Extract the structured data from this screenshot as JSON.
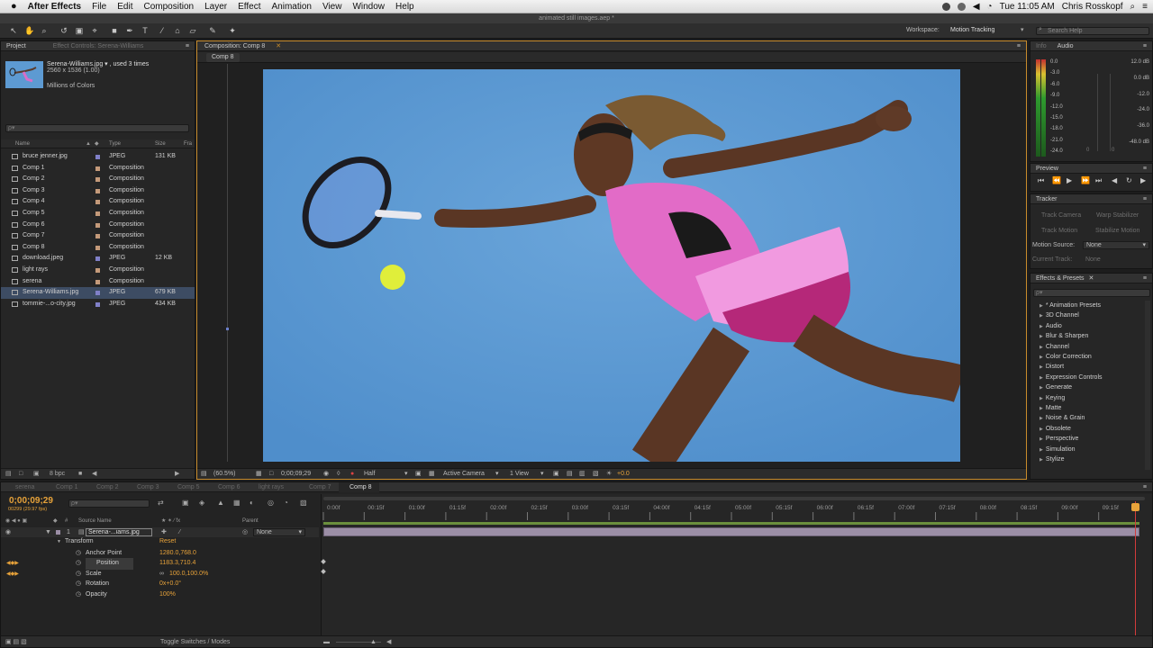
{
  "menubar": {
    "app": "After Effects",
    "items": [
      "File",
      "Edit",
      "Composition",
      "Layer",
      "Effect",
      "Animation",
      "View",
      "Window",
      "Help"
    ],
    "time": "Tue 11:05 AM",
    "user": "Chris Rosskopf"
  },
  "window_title": "animated still images.aep *",
  "toolbar": {
    "workspace_label": "Workspace:",
    "workspace_value": "Motion Tracking",
    "search_placeholder": "Search Help"
  },
  "project": {
    "tabs": [
      "Project",
      "Effect Controls: Serena-Williams"
    ],
    "selected_name": "Serena-Williams.jpg ▾ , used 3 times",
    "selected_dims": "2560 x 1536 (1.00)",
    "selected_colors": "Millions of Colors",
    "search_placeholder": "ρ▾",
    "columns": {
      "name": "Name",
      "type": "Type",
      "size": "Size",
      "fr": "Fra"
    },
    "items": [
      {
        "name": "bruce jenner.jpg",
        "type": "JPEG",
        "size": "131 KB",
        "kind": "jpeg"
      },
      {
        "name": "Comp 1",
        "type": "Composition",
        "size": "",
        "kind": "comp"
      },
      {
        "name": "Comp 2",
        "type": "Composition",
        "size": "",
        "kind": "comp"
      },
      {
        "name": "Comp 3",
        "type": "Composition",
        "size": "",
        "kind": "comp"
      },
      {
        "name": "Comp 4",
        "type": "Composition",
        "size": "",
        "kind": "comp"
      },
      {
        "name": "Comp 5",
        "type": "Composition",
        "size": "",
        "kind": "comp"
      },
      {
        "name": "Comp 6",
        "type": "Composition",
        "size": "",
        "kind": "comp"
      },
      {
        "name": "Comp 7",
        "type": "Composition",
        "size": "",
        "kind": "comp"
      },
      {
        "name": "Comp 8",
        "type": "Composition",
        "size": "",
        "kind": "comp"
      },
      {
        "name": "download.jpeg",
        "type": "JPEG",
        "size": "12 KB",
        "kind": "jpeg"
      },
      {
        "name": "light rays",
        "type": "Composition",
        "size": "",
        "kind": "comp"
      },
      {
        "name": "serena",
        "type": "Composition",
        "size": "",
        "kind": "comp"
      },
      {
        "name": "Serena-Williams.jpg",
        "type": "JPEG",
        "size": "679 KB",
        "kind": "jpeg",
        "selected": true
      },
      {
        "name": "tommie-...o-city.jpg",
        "type": "JPEG",
        "size": "434 KB",
        "kind": "jpeg"
      }
    ],
    "bpc": "8 bpc"
  },
  "composition": {
    "tab": "Composition: Comp 8",
    "breadcrumb": "Comp 8",
    "zoom": "(60.5%)",
    "timecode": "0;00;09;29",
    "resolution": "Half",
    "camera": "Active Camera",
    "view": "1 View",
    "exposure": "+0.0"
  },
  "info_audio": {
    "tabs": [
      "Info",
      "Audio"
    ],
    "left_db": [
      "0.0",
      "-3.0",
      "-6.0",
      "-9.0",
      "-12.0",
      "-15.0",
      "-18.0",
      "-21.0",
      "-24.0"
    ],
    "right_db": [
      "12.0 dB",
      "0.0 dB",
      "-12.0",
      "-24.0",
      "-36.0",
      "-48.0 dB"
    ],
    "bottom_zero_1": "0",
    "bottom_zero_2": "0"
  },
  "preview": {
    "title": "Preview"
  },
  "tracker": {
    "title": "Tracker",
    "track_camera": "Track Camera",
    "warp_stabilizer": "Warp Stabilizer",
    "track_motion": "Track Motion",
    "stabilize_motion": "Stabilize Motion",
    "motion_source_label": "Motion Source:",
    "motion_source_value": "None",
    "current_track_label": "Current Track:",
    "current_track_value": "None"
  },
  "effects": {
    "title": "Effects & Presets",
    "search_placeholder": "ρ▾",
    "items": [
      "* Animation Presets",
      "3D Channel",
      "Audio",
      "Blur & Sharpen",
      "Channel",
      "Color Correction",
      "Distort",
      "Expression Controls",
      "Generate",
      "Keying",
      "Matte",
      "Noise & Grain",
      "Obsolete",
      "Perspective",
      "Simulation",
      "Stylize"
    ]
  },
  "timeline": {
    "tabs": [
      {
        "label": "serena",
        "active": false
      },
      {
        "label": "Comp 1",
        "active": false
      },
      {
        "label": "Comp 2",
        "active": false
      },
      {
        "label": "Comp 3",
        "active": false
      },
      {
        "label": "Comp 5",
        "active": false
      },
      {
        "label": "Comp 6",
        "active": false
      },
      {
        "label": "light rays",
        "active": false
      },
      {
        "label": "Comp 7",
        "active": false
      },
      {
        "label": "Comp 8",
        "active": true
      }
    ],
    "timecode": "0;00;09;29",
    "frames": "00299 (29.97 fps)",
    "search_placeholder": "ρ▾",
    "col_source": "Source Name",
    "col_parent": "Parent",
    "layer_num": "1",
    "layer_name": "Serena-...iams.jpg",
    "parent_value": "None",
    "transform_label": "Transform",
    "reset_label": "Reset",
    "properties": [
      {
        "name": "Anchor Point",
        "value": "1280.0,768.0"
      },
      {
        "name": "Position",
        "value": "1183.3,710.4"
      },
      {
        "name": "Scale",
        "value": "100.0,100.0%"
      },
      {
        "name": "Rotation",
        "value": "0x+0.0°"
      },
      {
        "name": "Opacity",
        "value": "100%"
      }
    ],
    "ruler": [
      "0:00f",
      "00:15f",
      "01:00f",
      "01:15f",
      "02:00f",
      "02:15f",
      "03:00f",
      "03:15f",
      "04:00f",
      "04:15f",
      "05:00f",
      "05:15f",
      "06:00f",
      "06:15f",
      "07:00f",
      "07:15f",
      "08:00f",
      "08:15f",
      "09:00f",
      "09:15f"
    ],
    "toggle_label": "Toggle Switches / Modes"
  },
  "colors": {
    "accent": "#e8a33a",
    "canvas_blue": "#5d9ad2",
    "layer_bar": "#9b8ea6",
    "work_area": "#6a8f3d"
  }
}
